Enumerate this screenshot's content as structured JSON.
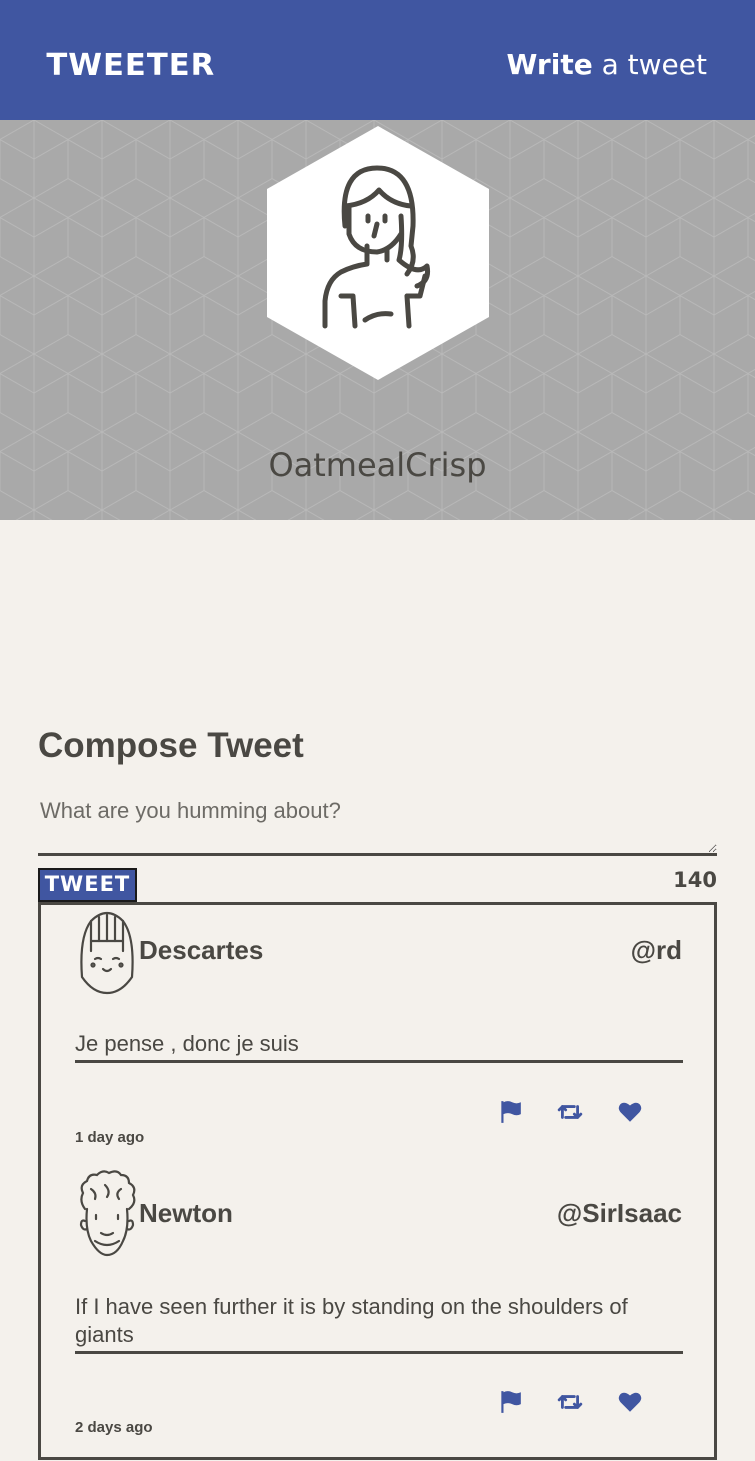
{
  "nav": {
    "logo": "TWEETER",
    "write_bold": "Write",
    "write_rest": " a tweet"
  },
  "profile": {
    "username": "OatmealCrisp"
  },
  "compose": {
    "title": "Compose Tweet",
    "placeholder": "What are you humming about?",
    "button_label": "TWEET",
    "counter": "140"
  },
  "tweets": [
    {
      "name": "Descartes",
      "handle": "@rd",
      "text": "Je pense , donc je suis",
      "date": "1 day ago"
    },
    {
      "name": "Newton",
      "handle": "@SirIsaac",
      "text": "If I have seen further it is by standing on the shoulders of giants",
      "date": "2 days ago"
    }
  ],
  "colors": {
    "accent": "#4056a1",
    "text": "#4a4843",
    "background": "#f4f1ec",
    "banner": "#a9a9a9"
  },
  "icons": [
    "flag-icon",
    "retweet-icon",
    "heart-icon"
  ]
}
